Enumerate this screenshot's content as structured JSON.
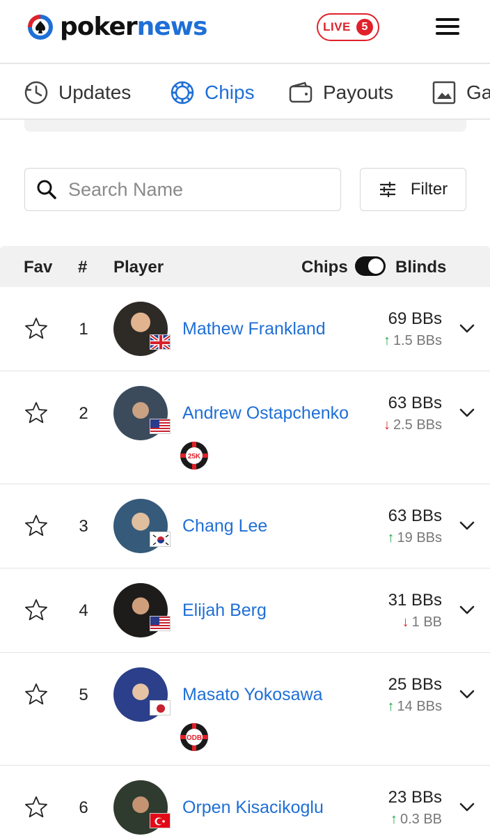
{
  "header": {
    "logo_part1": "poker",
    "logo_part2": "news",
    "live_label": "LIVE",
    "live_count": "5"
  },
  "tabs": [
    {
      "label": "Updates",
      "icon": "clock-icon"
    },
    {
      "label": "Chips",
      "icon": "chip-icon",
      "active": true
    },
    {
      "label": "Payouts",
      "icon": "wallet-icon"
    },
    {
      "label": "Gallery",
      "icon": "image-icon"
    }
  ],
  "search": {
    "placeholder": "Search Name"
  },
  "filter": {
    "label": "Filter"
  },
  "table_header": {
    "fav": "Fav",
    "rank": "#",
    "player": "Player",
    "chips": "Chips",
    "blinds": "Blinds",
    "toggle_on": true
  },
  "players": [
    {
      "rank": "1",
      "name": "Mathew Frankland",
      "flag": "uk",
      "stack": "69 BBs",
      "change": "1.5 BBs",
      "direction": "up",
      "badge": null
    },
    {
      "rank": "2",
      "name": "Andrew Ostapchenko",
      "flag": "us",
      "stack": "63 BBs",
      "change": "2.5 BBs",
      "direction": "down",
      "badge": "25K"
    },
    {
      "rank": "3",
      "name": "Chang Lee",
      "flag": "kr",
      "stack": "63 BBs",
      "change": "19 BBs",
      "direction": "up",
      "badge": null
    },
    {
      "rank": "4",
      "name": "Elijah Berg",
      "flag": "us",
      "stack": "31 BBs",
      "change": "1 BB",
      "direction": "down",
      "badge": null
    },
    {
      "rank": "5",
      "name": "Masato Yokosawa",
      "flag": "jp",
      "stack": "25 BBs",
      "change": "14 BBs",
      "direction": "up",
      "badge": "ODB"
    },
    {
      "rank": "6",
      "name": "Orpen Kisacikoglu",
      "flag": "tr",
      "stack": "23 BBs",
      "change": "0.3 BB",
      "direction": "up",
      "badge": null
    }
  ],
  "colors": {
    "accent": "#1f6fd6",
    "live": "#e0212a",
    "up": "#1fa64a",
    "down": "#e0212a"
  }
}
